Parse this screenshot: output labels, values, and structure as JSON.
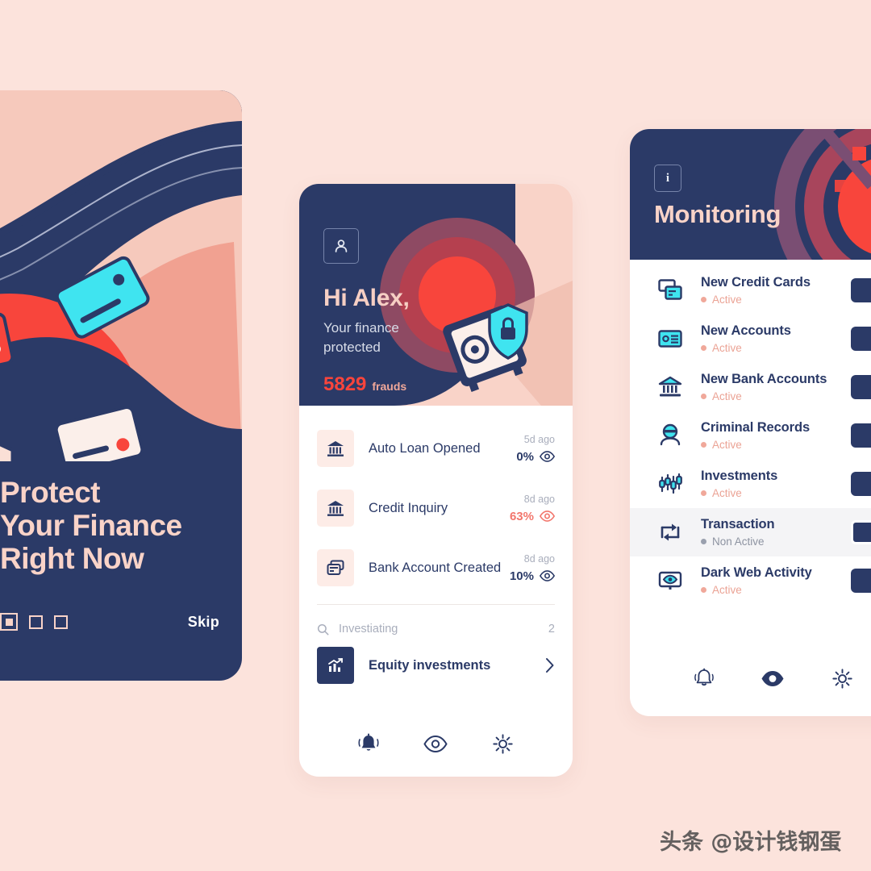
{
  "theme": {
    "bg": "#FCE3DC",
    "navy": "#2B3A67",
    "peach": "#F9D3C8",
    "red": "#F8453C",
    "cyan": "#3FE4F0",
    "white": "#FFFFFF"
  },
  "onboarding": {
    "title_lines": [
      "Protect",
      "Your Finance",
      "Right Now"
    ],
    "skip_label": "Skip",
    "page_indicator": {
      "total": 3,
      "active": 1
    },
    "illustration": "credit-cards-shield-lock-illustration"
  },
  "home": {
    "avatar_icon": "user-icon",
    "greeting": "Hi Alex,",
    "subtitle_lines": [
      "Your finance",
      "protected"
    ],
    "fraud_count": "5829",
    "fraud_label": "frauds",
    "illustration": "safe-vault-shield-lock-illustration",
    "activity": [
      {
        "icon": "bank-icon",
        "title": "Auto Loan Opened",
        "ago": "5d ago",
        "percent": "0%",
        "eye_icon": "eye-icon",
        "alert": false
      },
      {
        "icon": "bank-icon",
        "title": "Credit Inquiry",
        "ago": "8d ago",
        "percent": "63%",
        "eye_icon": "eye-icon",
        "alert": true
      },
      {
        "icon": "cards-icon",
        "title": "Bank Account Created",
        "ago": "8d ago",
        "percent": "10%",
        "eye_icon": "eye-icon",
        "alert": false
      }
    ],
    "investigating": {
      "search_icon": "search-icon",
      "label": "Investiating",
      "count": "2"
    },
    "equity": {
      "icon": "chart-up-icon",
      "label": "Equity investments",
      "chevron_icon": "chevron-right-icon"
    },
    "nav": [
      {
        "icon": "bell-icon",
        "label": "Alerts",
        "active": true
      },
      {
        "icon": "eye-icon",
        "label": "Monitoring",
        "active": false
      },
      {
        "icon": "gear-icon",
        "label": "Settings",
        "active": false
      }
    ]
  },
  "monitoring": {
    "info_icon": "info-icon",
    "info_label": "i",
    "title": "Monitoring",
    "illustration": "radar-rings-illustration",
    "items": [
      {
        "icon": "credit-cards-icon",
        "name": "New Credit Cards",
        "status": "Active",
        "enabled": true
      },
      {
        "icon": "id-card-icon",
        "name": "New Accounts",
        "status": "Active",
        "enabled": true
      },
      {
        "icon": "bank-icon",
        "name": "New Bank Accounts",
        "status": "Active",
        "enabled": true
      },
      {
        "icon": "criminal-person-icon",
        "name": "Criminal Records",
        "status": "Active",
        "enabled": true
      },
      {
        "icon": "candlestick-chart-icon",
        "name": "Investments",
        "status": "Active",
        "enabled": true
      },
      {
        "icon": "transfer-arrows-icon",
        "name": "Transaction",
        "status": "Non Active",
        "enabled": false
      },
      {
        "icon": "monitor-eye-icon",
        "name": "Dark Web Activity",
        "status": "Active",
        "enabled": true
      }
    ],
    "nav": [
      {
        "icon": "bell-icon",
        "label": "Alerts",
        "active": false
      },
      {
        "icon": "eye-icon",
        "label": "Monitoring",
        "active": true
      },
      {
        "icon": "gear-icon",
        "label": "Settings",
        "active": false
      }
    ]
  },
  "watermark": {
    "text": "头条 @设计钱钢蛋"
  }
}
